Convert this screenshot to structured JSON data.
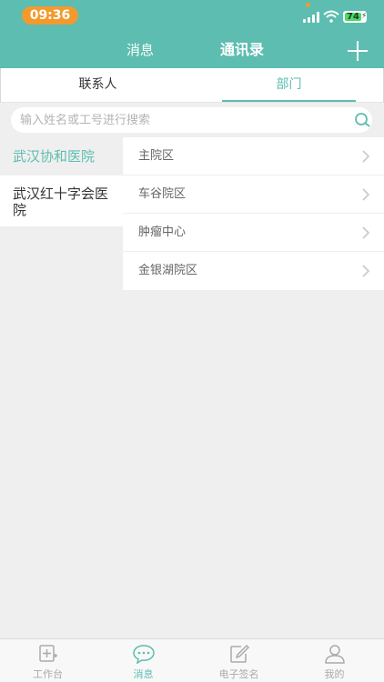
{
  "status_bar": {
    "time": "09:36",
    "battery": "74"
  },
  "nav": {
    "messages_label": "消息",
    "contacts_label": "通讯录"
  },
  "tabs": [
    {
      "label": "联系人",
      "active": false
    },
    {
      "label": "部门",
      "active": true
    }
  ],
  "search": {
    "placeholder": "输入姓名或工号进行搜索"
  },
  "hospitals": [
    {
      "name": "武汉协和医院",
      "selected": true
    },
    {
      "name": "武汉红十字会医院",
      "selected": false
    }
  ],
  "departments": [
    {
      "name": "主院区"
    },
    {
      "name": "车谷院区"
    },
    {
      "name": "肿瘤中心"
    },
    {
      "name": "金银湖院区"
    }
  ],
  "bottom_nav": [
    {
      "label": "工作台",
      "icon": "workbench-icon",
      "active": false
    },
    {
      "label": "消息",
      "icon": "chat-icon",
      "active": true
    },
    {
      "label": "电子签名",
      "icon": "signature-icon",
      "active": false
    },
    {
      "label": "我的",
      "icon": "user-icon",
      "active": false
    }
  ],
  "colors": {
    "accent": "#5dbdb0",
    "time_pill": "#f39a2e",
    "battery_green": "#4cd964"
  }
}
